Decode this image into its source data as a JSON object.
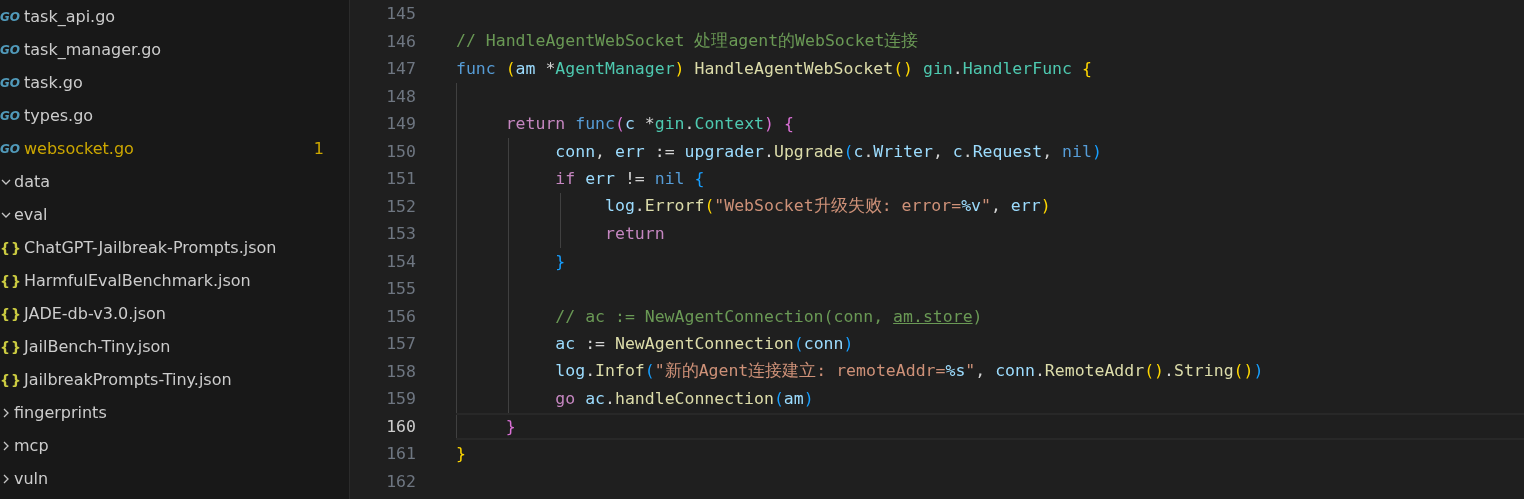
{
  "explorer": {
    "files": [
      {
        "name": "task_api.go",
        "icon": "GO",
        "problems": false
      },
      {
        "name": "task_manager.go",
        "icon": "GO",
        "problems": false
      },
      {
        "name": "task.go",
        "icon": "GO",
        "problems": false
      },
      {
        "name": "types.go",
        "icon": "GO",
        "problems": false
      },
      {
        "name": "websocket.go",
        "icon": "GO",
        "problems": true,
        "badge": "1"
      }
    ],
    "tree": [
      {
        "name": "data",
        "kind": "folder",
        "expanded": true,
        "children": [
          {
            "name": "eval",
            "kind": "folder",
            "expanded": true,
            "children": [
              {
                "name": "ChatGPT-Jailbreak-Prompts.json",
                "kind": "file",
                "icon": "{}"
              },
              {
                "name": "HarmfulEvalBenchmark.json",
                "kind": "file",
                "icon": "{}"
              },
              {
                "name": "JADE-db-v3.0.json",
                "kind": "file",
                "icon": "{}"
              },
              {
                "name": "JailBench-Tiny.json",
                "kind": "file",
                "icon": "{}"
              },
              {
                "name": "JailbreakPrompts-Tiny.json",
                "kind": "file",
                "icon": "{}"
              }
            ]
          },
          {
            "name": "fingerprints",
            "kind": "folder",
            "expanded": false
          },
          {
            "name": "mcp",
            "kind": "folder",
            "expanded": false
          },
          {
            "name": "vuln",
            "kind": "folder",
            "expanded": false
          }
        ]
      }
    ]
  },
  "editor": {
    "lines": [
      {
        "number": "145",
        "current": false
      },
      {
        "number": "146",
        "current": false,
        "tokens": [
          {
            "text": "// HandleAgentWebSocket 处理agent的WebSocket连接",
            "kind": "com"
          }
        ]
      },
      {
        "number": "147",
        "current": false,
        "tokens": [
          {
            "text": "func ",
            "kind": "kw"
          },
          {
            "text": "(",
            "kind": "b1"
          },
          {
            "text": "am",
            "kind": "var"
          },
          {
            "text": " *",
            "kind": "plain"
          },
          {
            "text": "AgentManager",
            "kind": "type"
          },
          {
            "text": ")",
            "kind": "b1"
          },
          {
            "text": " HandleAgentWebSocket",
            "kind": "fn"
          },
          {
            "text": "()",
            "kind": "b1"
          },
          {
            "text": " gin",
            "kind": "type"
          },
          {
            "text": ".",
            "kind": "plain"
          },
          {
            "text": "HandlerFunc",
            "kind": "type"
          },
          {
            "text": " {",
            "kind": "b1"
          }
        ]
      },
      {
        "number": "148",
        "current": false
      },
      {
        "number": "149",
        "current": false,
        "tokens": [
          {
            "text": "\treturn ",
            "kind": "ctrl"
          },
          {
            "text": "func",
            "kind": "kw"
          },
          {
            "text": "(",
            "kind": "b2"
          },
          {
            "text": "c",
            "kind": "var"
          },
          {
            "text": " *",
            "kind": "plain"
          },
          {
            "text": "gin",
            "kind": "type"
          },
          {
            "text": ".",
            "kind": "plain"
          },
          {
            "text": "Context",
            "kind": "type"
          },
          {
            "text": ")",
            "kind": "b2"
          },
          {
            "text": " {",
            "kind": "b2"
          }
        ]
      },
      {
        "number": "150",
        "current": false,
        "tokens": [
          {
            "text": "\t\tconn",
            "kind": "var"
          },
          {
            "text": ", ",
            "kind": "plain"
          },
          {
            "text": "err",
            "kind": "var"
          },
          {
            "text": " := ",
            "kind": "plain"
          },
          {
            "text": "upgrader",
            "kind": "var"
          },
          {
            "text": ".",
            "kind": "plain"
          },
          {
            "text": "Upgrade",
            "kind": "fn"
          },
          {
            "text": "(",
            "kind": "b3"
          },
          {
            "text": "c",
            "kind": "var"
          },
          {
            "text": ".",
            "kind": "plain"
          },
          {
            "text": "Writer",
            "kind": "var"
          },
          {
            "text": ", ",
            "kind": "plain"
          },
          {
            "text": "c",
            "kind": "var"
          },
          {
            "text": ".",
            "kind": "plain"
          },
          {
            "text": "Request",
            "kind": "var"
          },
          {
            "text": ", ",
            "kind": "plain"
          },
          {
            "text": "nil",
            "kind": "kw"
          },
          {
            "text": ")",
            "kind": "b3"
          }
        ]
      },
      {
        "number": "151",
        "current": false,
        "tokens": [
          {
            "text": "\t\tif ",
            "kind": "ctrl"
          },
          {
            "text": "err",
            "kind": "var"
          },
          {
            "text": " != ",
            "kind": "plain"
          },
          {
            "text": "nil",
            "kind": "kw"
          },
          {
            "text": " {",
            "kind": "b3"
          }
        ]
      },
      {
        "number": "152",
        "current": false,
        "tokens": [
          {
            "text": "\t\t\tlog",
            "kind": "var"
          },
          {
            "text": ".",
            "kind": "plain"
          },
          {
            "text": "Errorf",
            "kind": "fn"
          },
          {
            "text": "(",
            "kind": "b1"
          },
          {
            "text": "\"WebSocket升级失败: error=",
            "kind": "str"
          },
          {
            "text": "%v",
            "kind": "var"
          },
          {
            "text": "\"",
            "kind": "str"
          },
          {
            "text": ", ",
            "kind": "plain"
          },
          {
            "text": "err",
            "kind": "var"
          },
          {
            "text": ")",
            "kind": "b1"
          }
        ]
      },
      {
        "number": "153",
        "current": false,
        "tokens": [
          {
            "text": "\t\t\treturn",
            "kind": "ctrl"
          }
        ]
      },
      {
        "number": "154",
        "current": false,
        "tokens": [
          {
            "text": "\t\t}",
            "kind": "b3"
          }
        ]
      },
      {
        "number": "155",
        "current": false
      },
      {
        "number": "156",
        "current": false,
        "tokens": [
          {
            "text": "\t\t// ac := NewAgentConnection(conn, ",
            "kind": "com"
          },
          {
            "text": "am.store",
            "kind": "com-u"
          },
          {
            "text": ")",
            "kind": "com"
          }
        ]
      },
      {
        "number": "157",
        "current": false,
        "tokens": [
          {
            "text": "\t\tac",
            "kind": "var"
          },
          {
            "text": " := ",
            "kind": "plain"
          },
          {
            "text": "NewAgentConnection",
            "kind": "fn"
          },
          {
            "text": "(",
            "kind": "b3"
          },
          {
            "text": "conn",
            "kind": "var"
          },
          {
            "text": ")",
            "kind": "b3"
          }
        ]
      },
      {
        "number": "158",
        "current": false,
        "tokens": [
          {
            "text": "\t\tlog",
            "kind": "var"
          },
          {
            "text": ".",
            "kind": "plain"
          },
          {
            "text": "Infof",
            "kind": "fn"
          },
          {
            "text": "(",
            "kind": "b3"
          },
          {
            "text": "\"新的Agent连接建立: remoteAddr=",
            "kind": "str"
          },
          {
            "text": "%s",
            "kind": "var"
          },
          {
            "text": "\"",
            "kind": "str"
          },
          {
            "text": ", ",
            "kind": "plain"
          },
          {
            "text": "conn",
            "kind": "var"
          },
          {
            "text": ".",
            "kind": "plain"
          },
          {
            "text": "RemoteAddr",
            "kind": "fn"
          },
          {
            "text": "()",
            "kind": "b1"
          },
          {
            "text": ".",
            "kind": "plain"
          },
          {
            "text": "String",
            "kind": "fn"
          },
          {
            "text": "()",
            "kind": "b1"
          },
          {
            "text": ")",
            "kind": "b3"
          }
        ]
      },
      {
        "number": "159",
        "current": false,
        "tokens": [
          {
            "text": "\t\tgo ",
            "kind": "ctrl"
          },
          {
            "text": "ac",
            "kind": "var"
          },
          {
            "text": ".",
            "kind": "plain"
          },
          {
            "text": "handleConnection",
            "kind": "fn"
          },
          {
            "text": "(",
            "kind": "b3"
          },
          {
            "text": "am",
            "kind": "var"
          },
          {
            "text": ")",
            "kind": "b3"
          }
        ]
      },
      {
        "number": "160",
        "current": true,
        "tokens": [
          {
            "text": "\t}",
            "kind": "b2"
          }
        ]
      },
      {
        "number": "161",
        "current": false,
        "tokens": [
          {
            "text": "}",
            "kind": "b1"
          }
        ]
      },
      {
        "number": "162",
        "current": false
      }
    ]
  }
}
